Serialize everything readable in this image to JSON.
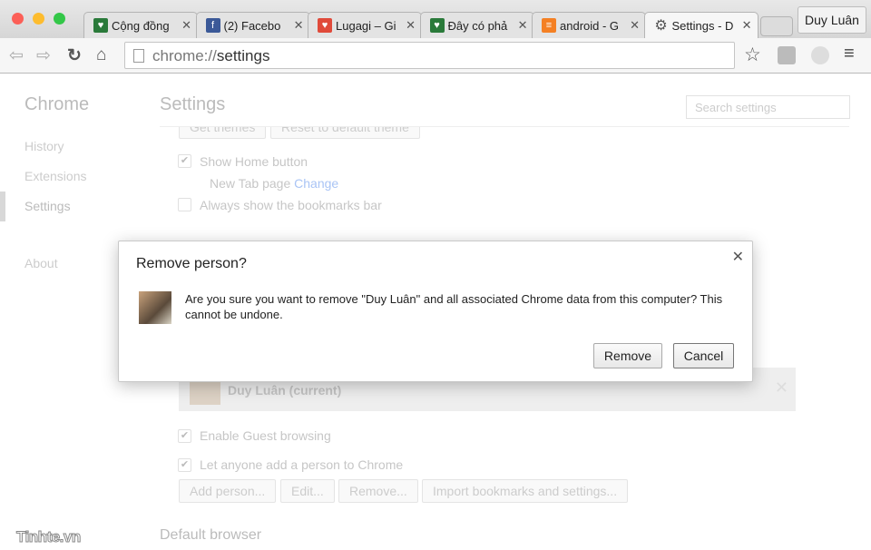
{
  "window": {
    "traffic_lights": [
      "#fc5f57",
      "#fdbc2e",
      "#33c748"
    ]
  },
  "tabs": [
    {
      "title": "Cộng đồng",
      "icon": "tinhte-icon",
      "color": "#2a7a3a"
    },
    {
      "title": "(2) Facebo",
      "icon": "facebook-icon",
      "color": "#3b5998"
    },
    {
      "title": "Lugagi – Gi",
      "icon": "lugagi-icon",
      "color": "#e04a3a"
    },
    {
      "title": "Đây có phả",
      "icon": "tinhte-icon",
      "color": "#2a7a3a"
    },
    {
      "title": "android - G",
      "icon": "stackoverflow-icon",
      "color": "#f48024"
    },
    {
      "title": "Settings - D",
      "icon": "gear-icon",
      "color": "#555555",
      "active": true
    }
  ],
  "profile_button": "Duy Luân",
  "omnibox": {
    "scheme": "chrome://",
    "path": "settings"
  },
  "sidebar": {
    "title": "Chrome",
    "items": [
      "History",
      "Extensions",
      "Settings",
      "About"
    ],
    "selected": "Settings"
  },
  "main": {
    "title": "Settings",
    "search_placeholder": "Search settings",
    "theme_buttons": [
      "Get themes",
      "Reset to default theme"
    ],
    "show_home": "Show Home button",
    "new_tab_page": "New Tab page",
    "change_link": "Change",
    "bookmarks_bar": "Always show the bookmarks bar",
    "person": "Duy Luân (current)",
    "guest": "Enable Guest browsing",
    "add_person_check": "Let anyone add a person to Chrome",
    "people_buttons": [
      "Add person...",
      "Edit...",
      "Remove...",
      "Import bookmarks and settings..."
    ],
    "default_browser": "Default browser",
    "link_color": "#4a8af4"
  },
  "dialog": {
    "title": "Remove person?",
    "message": "Are you sure you want to remove \"Duy Luân\" and all associated Chrome data from this computer? This cannot be undone.",
    "remove": "Remove",
    "cancel": "Cancel"
  },
  "watermark": "Tinhte.vn"
}
